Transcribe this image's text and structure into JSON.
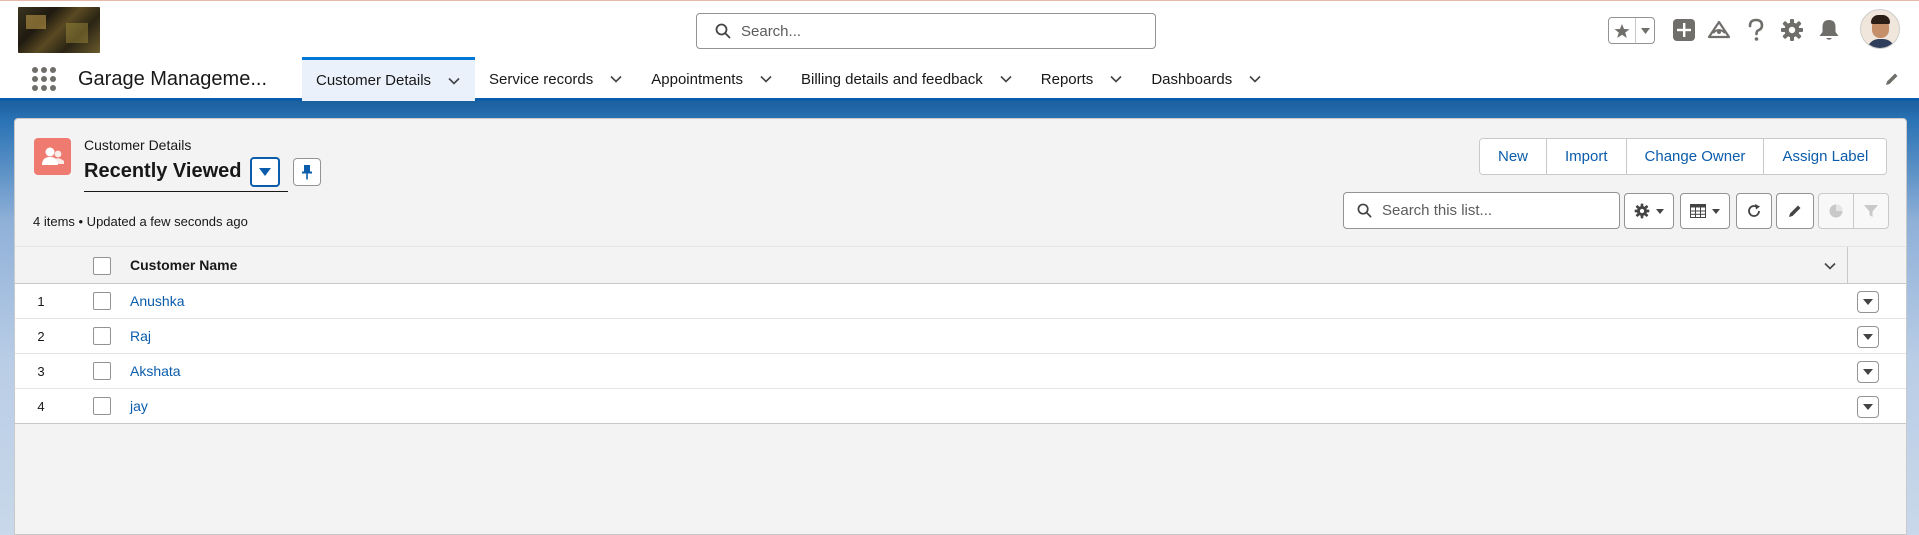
{
  "header": {
    "search_placeholder": "Search..."
  },
  "nav": {
    "app_name": "Garage Manageme...",
    "items": [
      {
        "label": "Customer Details",
        "active": true
      },
      {
        "label": "Service records"
      },
      {
        "label": "Appointments"
      },
      {
        "label": "Billing details and feedback"
      },
      {
        "label": "Reports"
      },
      {
        "label": "Dashboards"
      }
    ]
  },
  "list": {
    "object_label": "Customer Details",
    "view_name": "Recently Viewed",
    "info": "4 items • Updated a few seconds ago",
    "actions": [
      "New",
      "Import",
      "Change Owner",
      "Assign Label"
    ],
    "search_placeholder": "Search this list...",
    "columns": [
      "Customer Name"
    ],
    "rows": [
      {
        "num": "1",
        "name": "Anushka"
      },
      {
        "num": "2",
        "name": "Raj"
      },
      {
        "num": "3",
        "name": "Akshata"
      },
      {
        "num": "4",
        "name": "jay"
      }
    ]
  },
  "colors": {
    "brand_blue": "#0b5cab",
    "object_icon": "#ef7a6f",
    "nav_active_bg": "#eaf1fb"
  },
  "icons": [
    "search-icon",
    "star-icon",
    "add-icon",
    "trailhead-icon",
    "help-icon",
    "gear-icon",
    "bell-icon",
    "app-launcher-icon",
    "chevron-down-icon",
    "pencil-icon",
    "customer-object-icon",
    "pin-icon",
    "refresh-icon",
    "table-icon",
    "chart-icon",
    "filter-icon"
  ]
}
